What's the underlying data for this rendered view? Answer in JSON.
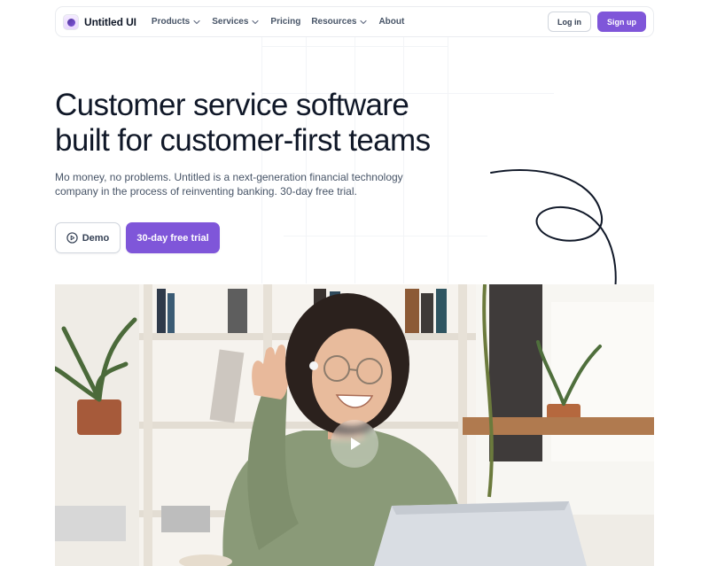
{
  "brand": {
    "name": "Untitled UI"
  },
  "nav": {
    "items": [
      {
        "label": "Products",
        "has_dropdown": true
      },
      {
        "label": "Services",
        "has_dropdown": true
      },
      {
        "label": "Pricing",
        "has_dropdown": false
      },
      {
        "label": "Resources",
        "has_dropdown": true
      },
      {
        "label": "About",
        "has_dropdown": false
      }
    ],
    "login_label": "Log in",
    "signup_label": "Sign up"
  },
  "hero": {
    "headline_line1": "Customer service software",
    "headline_line2": "built for customer-first teams",
    "subtext": "Mo money, no problems. Untitled is a next-generation financial technology company in the process of reinventing banking. 30-day free trial.",
    "demo_label": "Demo",
    "trial_label": "30-day free trial"
  },
  "colors": {
    "accent": "#7f56d9",
    "text_primary": "#101828",
    "text_secondary": "#475467",
    "border": "#d0d5dd"
  },
  "icons": {
    "logo": "logo-mark-icon",
    "dropdown": "chevron-down-icon",
    "demo": "play-circle-icon",
    "video": "play-icon",
    "doodle": "curly-arrow-icon"
  }
}
